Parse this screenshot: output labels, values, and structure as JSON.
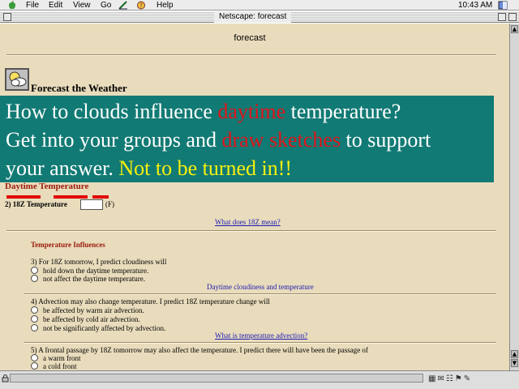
{
  "menubar": {
    "items": [
      "File",
      "Edit",
      "View",
      "Go",
      "Help"
    ],
    "clock": "10:43 AM"
  },
  "window": {
    "title": "Netscape: forecast"
  },
  "page": {
    "heading": "forecast",
    "section_title": "Forecast the Weather",
    "daytime_heading": "Daytime Temperature",
    "temp_label": "2) 18Z Temperature",
    "temp_unit": "(F)",
    "link_18z": "What does 18Z mean?",
    "influences_heading": "Temperature Influences",
    "q3": "3) For 18Z tomorrow, I predict cloudiness will",
    "q3_options": [
      "hold down the daytime temperature.",
      "not affect the daytime temperature."
    ],
    "link_cloudiness": "Daytime cloudiness and temperature",
    "q4": "4) Advection may also change temperature. I predict 18Z temperature change will",
    "q4_options": [
      "be affected by warm air advection.",
      "be affected by cold air advection.",
      "not be significantly affected by advection."
    ],
    "link_advection": "What is temperature advection?",
    "q5": "5) A frontal passage by 18Z tomorrow may also affect the temperature. I predict there will have been the passage of",
    "q5_options": [
      "a warm front",
      "a cold front"
    ]
  },
  "overlay": {
    "line1_a": "How to clouds influence ",
    "line1_b": "daytime",
    "line1_c": " temperature?",
    "line2_a": "Get into your groups and ",
    "line2_b": "draw sketches",
    "line2_c": " to support",
    "line3_a": " your answer. ",
    "line3_b": "Not to be turned in!!"
  },
  "colors": {
    "page_background": "#e9dcbc",
    "overlay_background": "#127a74",
    "overlay_highlight_red": "#e0141a",
    "overlay_highlight_yellow": "#f8f00e",
    "heading_red": "#9a1a0c",
    "link_blue": "#1a1ab4"
  },
  "icons": [
    "apple-icon",
    "cloud-sun-icon",
    "netscape-icon",
    "help-icon",
    "finder-icon"
  ]
}
